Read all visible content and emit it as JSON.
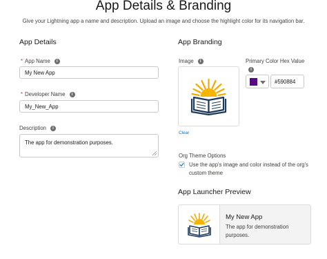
{
  "page": {
    "title": "App Details & Branding",
    "subtitle": "Give your Lightning app a name and description. Upload an image and choose the highlight color for its navigation bar."
  },
  "details": {
    "section_title": "App Details",
    "app_name_label": "App Name",
    "app_name_value": "My New App",
    "developer_name_label": "Developer Name",
    "developer_name_value": "My_New_App",
    "description_label": "Description",
    "description_value": "The app for demonstration purposes."
  },
  "branding": {
    "section_title": "App Branding",
    "image_label": "Image",
    "clear_label": "Clear",
    "color_label": "Primary Color Hex Value",
    "color_value": "#590884",
    "color_hex": "#590884",
    "org_theme_label": "Org Theme Options",
    "org_theme_checked": true,
    "org_theme_text": "Use the app's image and color instead of the org's custom theme"
  },
  "preview": {
    "section_title": "App Launcher Preview",
    "app_title": "My New App",
    "app_desc": "The app for demonstration purposes."
  },
  "icons": {
    "required": "*",
    "info": "i"
  }
}
